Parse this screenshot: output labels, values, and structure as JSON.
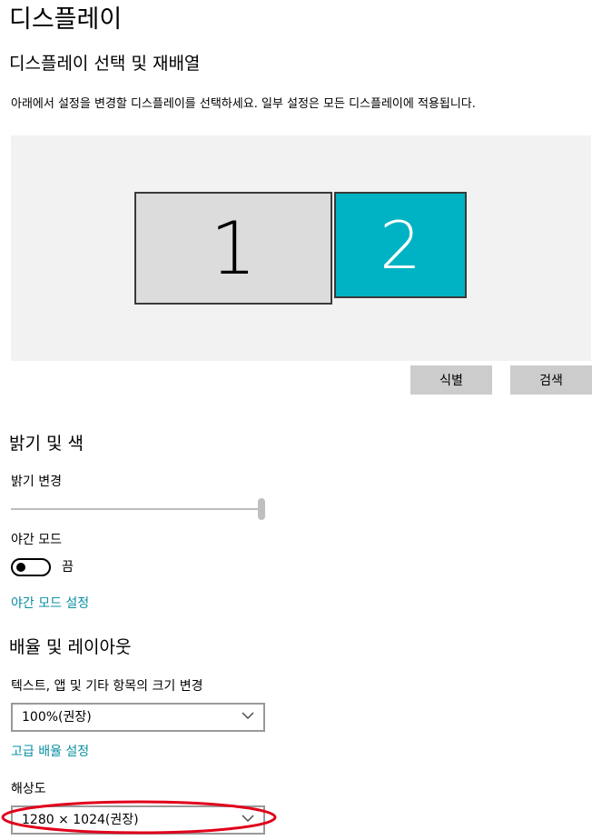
{
  "page": {
    "title": "디스플레이",
    "arrange_heading": "디스플레이 선택 및 재배열",
    "arrange_description": "아래에서 설정을 변경할 디스플레이를 선택하세요. 일부 설정은 모든 디스플레이에 적용됩니다."
  },
  "monitors": [
    {
      "number": "1",
      "selected": false,
      "color": "#dcdcdc"
    },
    {
      "number": "2",
      "selected": true,
      "color": "#00b3c4"
    }
  ],
  "buttons": {
    "identify": "식별",
    "detect": "검색"
  },
  "brightness": {
    "heading": "밝기 및 색",
    "label": "밝기 변경",
    "value_percent": 100,
    "night_mode_label": "야간 모드",
    "night_mode_state": "끔",
    "night_mode_link": "야간 모드 설정"
  },
  "scale": {
    "heading": "배율 및 레이아웃",
    "label": "텍스트, 앱 및 기타 항목의 크기 변경",
    "value": "100%(권장)",
    "advanced_link": "고급 배율 설정"
  },
  "resolution": {
    "label": "해상도",
    "value": "1280 × 1024(권장)",
    "highlight_color": "#e0001b"
  },
  "theme": {
    "accent": "#0a8fa3"
  }
}
